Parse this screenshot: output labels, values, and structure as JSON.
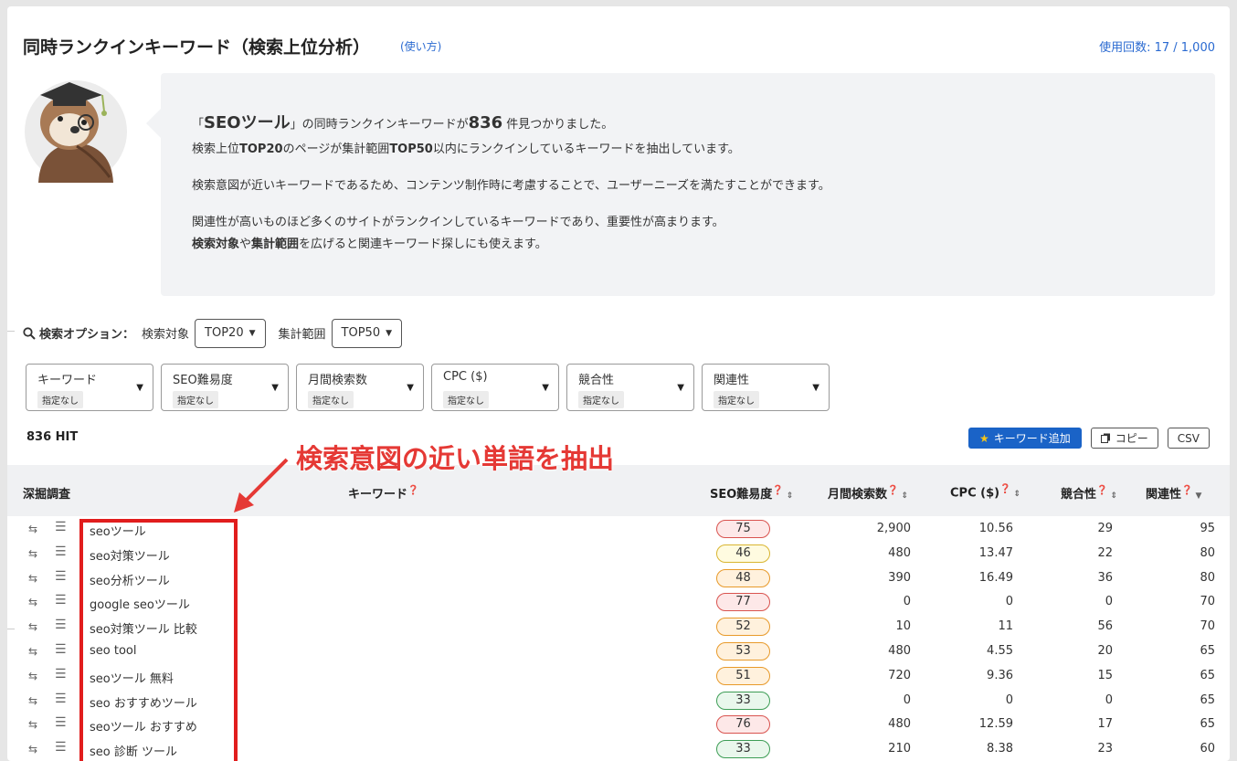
{
  "header": {
    "title": "同時ランクインキーワード（検索上位分析）",
    "help_link": "(使い方)",
    "usage": "使用回数: 17 / 1,000"
  },
  "info": {
    "line1_pre": "「",
    "line1_term": "SEOツール",
    "line1_mid": "」の同時ランクインキーワードが",
    "line1_count": "836",
    "line1_post": " 件見つかりました。",
    "line2_a": "検索上位",
    "line2_b": "TOP20",
    "line2_c": "のページが集計範囲",
    "line2_d": "TOP50",
    "line2_e": "以内にランクインしているキーワードを抽出しています。",
    "line3": "検索意図が近いキーワードであるため、コンテンツ制作時に考慮することで、ユーザーニーズを満たすことができます。",
    "line4": "関連性が高いものほど多くのサイトがランクインしているキーワードであり、重要性が高まります。",
    "line5_a": "検索対象",
    "line5_b": "や",
    "line5_c": "集計範囲",
    "line5_d": "を広げると関連キーワード探しにも使えます。"
  },
  "options": {
    "label": "検索オプション：",
    "target_label": "検索対象",
    "target_value": "TOP20",
    "range_label": "集計範囲",
    "range_value": "TOP50"
  },
  "filters": [
    {
      "name": "キーワード",
      "value": "指定なし"
    },
    {
      "name": "SEO難易度",
      "value": "指定なし"
    },
    {
      "name": "月間検索数",
      "value": "指定なし"
    },
    {
      "name": "CPC ($)",
      "value": "指定なし"
    },
    {
      "name": "競合性",
      "value": "指定なし"
    },
    {
      "name": "関連性",
      "value": "指定なし"
    }
  ],
  "hit_count": "836 HIT",
  "buttons": {
    "add_keyword": "キーワード追加",
    "copy": "コピー",
    "csv": "CSV"
  },
  "annotation": "検索意図の近い単語を抽出",
  "table": {
    "headers": {
      "dig": "深掘調査",
      "keyword": "キーワード",
      "seo": "SEO難易度",
      "volume": "月間検索数",
      "cpc": "CPC ($)",
      "competition": "競合性",
      "relevance": "関連性"
    },
    "rows": [
      {
        "keyword": "seoツール",
        "seo": "75",
        "level": "red",
        "volume": "2,900",
        "cpc": "10.56",
        "competition": "29",
        "relevance": "95"
      },
      {
        "keyword": "seo対策ツール",
        "seo": "46",
        "level": "yellow",
        "volume": "480",
        "cpc": "13.47",
        "competition": "22",
        "relevance": "80"
      },
      {
        "keyword": "seo分析ツール",
        "seo": "48",
        "level": "orange",
        "volume": "390",
        "cpc": "16.49",
        "competition": "36",
        "relevance": "80"
      },
      {
        "keyword": "google seoツール",
        "seo": "77",
        "level": "red",
        "volume": "0",
        "cpc": "0",
        "competition": "0",
        "relevance": "70"
      },
      {
        "keyword": "seo対策ツール 比較",
        "seo": "52",
        "level": "orange",
        "volume": "10",
        "cpc": "11",
        "competition": "56",
        "relevance": "70"
      },
      {
        "keyword": "seo tool",
        "seo": "53",
        "level": "orange",
        "volume": "480",
        "cpc": "4.55",
        "competition": "20",
        "relevance": "65"
      },
      {
        "keyword": "seoツール 無料",
        "seo": "51",
        "level": "orange",
        "volume": "720",
        "cpc": "9.36",
        "competition": "15",
        "relevance": "65"
      },
      {
        "keyword": "seo おすすめツール",
        "seo": "33",
        "level": "green",
        "volume": "0",
        "cpc": "0",
        "competition": "0",
        "relevance": "65"
      },
      {
        "keyword": "seoツール おすすめ",
        "seo": "76",
        "level": "red",
        "volume": "480",
        "cpc": "12.59",
        "competition": "17",
        "relevance": "65"
      },
      {
        "keyword": "seo 診断 ツール",
        "seo": "33",
        "level": "green",
        "volume": "210",
        "cpc": "8.38",
        "competition": "23",
        "relevance": "60"
      }
    ]
  },
  "level_colors": {
    "red": {
      "bg": "#fde8e8",
      "border": "#d9534f"
    },
    "orange": {
      "bg": "#fff1dd",
      "border": "#e89a2a"
    },
    "yellow": {
      "bg": "#fffbe0",
      "border": "#d9b530"
    },
    "green": {
      "bg": "#e9f7ec",
      "border": "#3d9d55"
    }
  },
  "icons": {
    "search": "search-icon",
    "retweet": "repeat-icon",
    "menu": "list-icon",
    "star": "star-icon",
    "copy": "copy-icon",
    "help": "question-icon"
  }
}
